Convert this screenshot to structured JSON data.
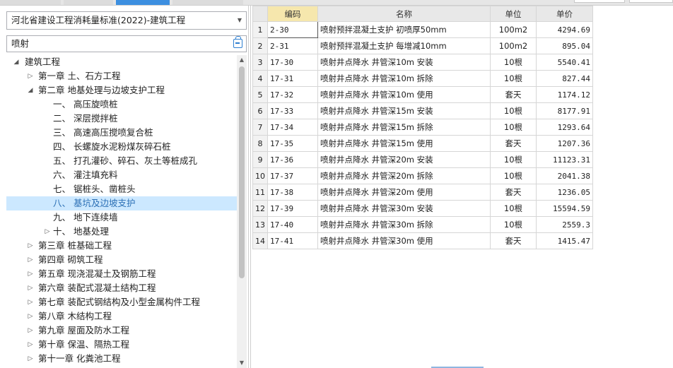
{
  "left_panel": {
    "dropdown_value": "河北省建设工程消耗量标准(2022)-建筑工程",
    "search_value": "喷射",
    "tree": [
      {
        "label": "建筑工程",
        "level": 0,
        "toggle": "◢",
        "selected": false
      },
      {
        "label": "第一章 土、石方工程",
        "level": 1,
        "toggle": "▷",
        "selected": false
      },
      {
        "label": "第二章 地基处理与边坡支护工程",
        "level": 1,
        "toggle": "◢",
        "selected": false
      },
      {
        "label": "一、 高压旋喷桩",
        "level": 2,
        "toggle": "",
        "selected": false
      },
      {
        "label": "二、 深层搅拌桩",
        "level": 2,
        "toggle": "",
        "selected": false
      },
      {
        "label": "三、 高速高压搅喷复合桩",
        "level": 2,
        "toggle": "",
        "selected": false
      },
      {
        "label": "四、 长螺旋水泥粉煤灰碎石桩",
        "level": 2,
        "toggle": "",
        "selected": false
      },
      {
        "label": "五、 打孔灌砂、碎石、灰土等桩成孔",
        "level": 2,
        "toggle": "",
        "selected": false
      },
      {
        "label": "六、 灌注填充料",
        "level": 2,
        "toggle": "",
        "selected": false
      },
      {
        "label": "七、 锯桩头、凿桩头",
        "level": 2,
        "toggle": "",
        "selected": false
      },
      {
        "label": "八、 基坑及边坡支护",
        "level": 2,
        "toggle": "",
        "selected": true
      },
      {
        "label": "九、 地下连续墙",
        "level": 2,
        "toggle": "",
        "selected": false
      },
      {
        "label": "十、 地基处理",
        "level": 2,
        "toggle": "▷",
        "selected": false
      },
      {
        "label": "第三章 桩基础工程",
        "level": 1,
        "toggle": "▷",
        "selected": false
      },
      {
        "label": "第四章 砌筑工程",
        "level": 1,
        "toggle": "▷",
        "selected": false
      },
      {
        "label": "第五章 现浇混凝土及钢筋工程",
        "level": 1,
        "toggle": "▷",
        "selected": false
      },
      {
        "label": "第六章 装配式混凝土结构工程",
        "level": 1,
        "toggle": "▷",
        "selected": false
      },
      {
        "label": "第七章 装配式钢结构及小型金属构件工程",
        "level": 1,
        "toggle": "▷",
        "selected": false
      },
      {
        "label": "第八章 木结构工程",
        "level": 1,
        "toggle": "▷",
        "selected": false
      },
      {
        "label": "第九章 屋面及防水工程",
        "level": 1,
        "toggle": "▷",
        "selected": false
      },
      {
        "label": "第十章 保温、隔热工程",
        "level": 1,
        "toggle": "▷",
        "selected": false
      },
      {
        "label": "第十一章 化粪池工程",
        "level": 1,
        "toggle": "▷",
        "selected": false
      }
    ]
  },
  "grid": {
    "headers": {
      "code": "编码",
      "name": "名称",
      "unit": "单位",
      "price": "单价"
    },
    "rows": [
      {
        "no": "1",
        "code": "2-30",
        "name": "喷射预拌混凝土支护 初喷厚50mm",
        "unit": "100m2",
        "price": "4294.69"
      },
      {
        "no": "2",
        "code": "2-31",
        "name": "喷射预拌混凝土支护 每增减10mm",
        "unit": "100m2",
        "price": "895.04"
      },
      {
        "no": "3",
        "code": "17-30",
        "name": "喷射井点降水 井管深10m 安装",
        "unit": "10根",
        "price": "5540.41"
      },
      {
        "no": "4",
        "code": "17-31",
        "name": "喷射井点降水 井管深10m 拆除",
        "unit": "10根",
        "price": "827.44"
      },
      {
        "no": "5",
        "code": "17-32",
        "name": "喷射井点降水 井管深10m 使用",
        "unit": "套天",
        "price": "1174.12"
      },
      {
        "no": "6",
        "code": "17-33",
        "name": "喷射井点降水 井管深15m 安装",
        "unit": "10根",
        "price": "8177.91"
      },
      {
        "no": "7",
        "code": "17-34",
        "name": "喷射井点降水 井管深15m 拆除",
        "unit": "10根",
        "price": "1293.64"
      },
      {
        "no": "8",
        "code": "17-35",
        "name": "喷射井点降水 井管深15m 使用",
        "unit": "套天",
        "price": "1207.36"
      },
      {
        "no": "9",
        "code": "17-36",
        "name": "喷射井点降水 井管深20m 安装",
        "unit": "10根",
        "price": "11123.31"
      },
      {
        "no": "10",
        "code": "17-37",
        "name": "喷射井点降水 井管深20m 拆除",
        "unit": "10根",
        "price": "2041.38"
      },
      {
        "no": "11",
        "code": "17-38",
        "name": "喷射井点降水 井管深20m 使用",
        "unit": "套天",
        "price": "1236.05"
      },
      {
        "no": "12",
        "code": "17-39",
        "name": "喷射井点降水 井管深30m 安装",
        "unit": "10根",
        "price": "15594.59"
      },
      {
        "no": "13",
        "code": "17-40",
        "name": "喷射井点降水 井管深30m 拆除",
        "unit": "10根",
        "price": "2559.3"
      },
      {
        "no": "14",
        "code": "17-41",
        "name": "喷射井点降水 井管深30m 使用",
        "unit": "套天",
        "price": "1415.47"
      }
    ]
  },
  "colors": {
    "accent_tab": "#3d8fe0",
    "selected_row": "#cce8ff",
    "code_header": "#f6e7ad"
  }
}
